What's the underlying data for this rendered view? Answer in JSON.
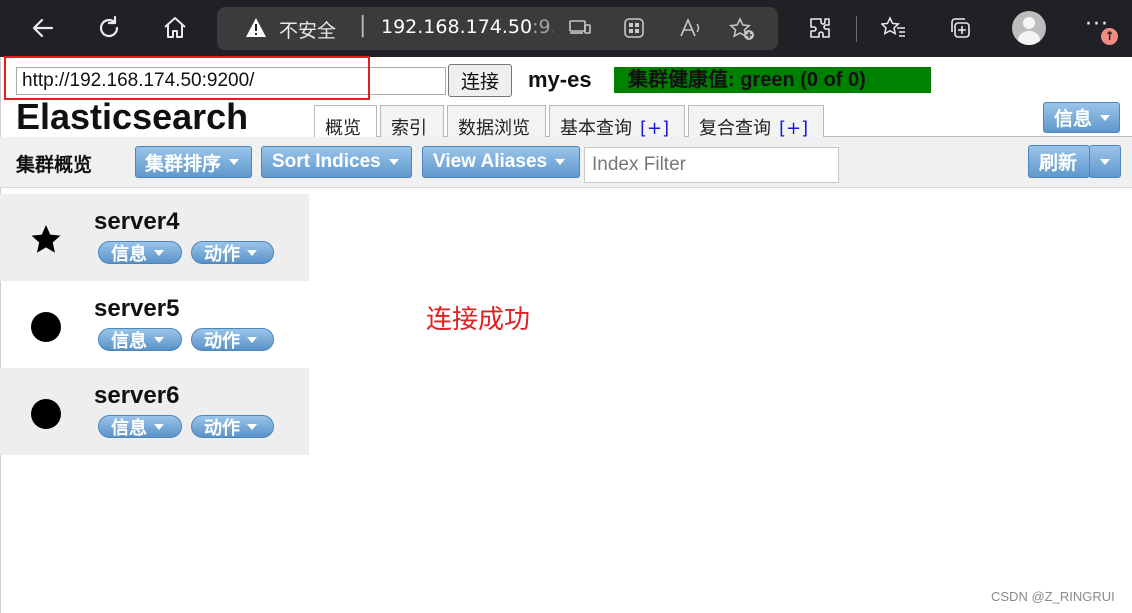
{
  "browser": {
    "insecure_label": "不安全",
    "separator": "|",
    "url_host": "192.168.174.50",
    "url_rest": ":9...",
    "more_label": "···",
    "notification_badge": "↑"
  },
  "header": {
    "connect_url": "http://192.168.174.50:9200/",
    "connect_label": "连接",
    "cluster_name": "my-es",
    "cluster_health": "集群健康值: green (0 of 0)",
    "health_color": "#008000",
    "brand": "Elasticsearch",
    "tabs": [
      {
        "label": "概览",
        "plus": ""
      },
      {
        "label": "索引",
        "plus": ""
      },
      {
        "label": "数据浏览",
        "plus": ""
      },
      {
        "label": "基本查询",
        "plus": "[+]"
      },
      {
        "label": "复合查询",
        "plus": "[+]"
      }
    ],
    "info_label": "信息"
  },
  "toolbar": {
    "title": "集群概览",
    "sort_cluster_label": "集群排序",
    "sort_indices_label": "Sort Indices",
    "view_aliases_label": "View Aliases",
    "filter_placeholder": "Index Filter",
    "refresh_label": "刷新"
  },
  "nodes": [
    {
      "name": "server4",
      "marker": "star-icon",
      "info_label": "信息",
      "action_label": "动作"
    },
    {
      "name": "server5",
      "marker": "circle-icon",
      "info_label": "信息",
      "action_label": "动作"
    },
    {
      "name": "server6",
      "marker": "circle-icon",
      "info_label": "信息",
      "action_label": "动作"
    }
  ],
  "annotation": "连接成功",
  "annotation_color": "#e02020",
  "watermark": "CSDN @Z_RINGRUI"
}
